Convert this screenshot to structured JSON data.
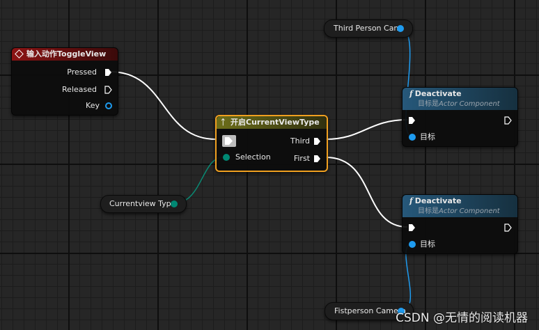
{
  "input_node": {
    "title": "输入动作ToggleView",
    "pressed": "Pressed",
    "released": "Released",
    "key": "Key"
  },
  "switch_node": {
    "title": "开启CurrentViewType",
    "third": "Third",
    "first": "First",
    "selection": "Selection"
  },
  "deactivate_top": {
    "title": "Deactivate",
    "subtitle_prefix": "目标是",
    "subtitle_target": "Actor Component",
    "target_label": "目标"
  },
  "deactivate_bottom": {
    "title": "Deactivate",
    "subtitle_prefix": "目标是",
    "subtitle_target": "Actor Component",
    "target_label": "目标"
  },
  "var_third_person_cam": {
    "label": "Third Person Cam"
  },
  "var_currentview_type": {
    "label": "Currentview Type"
  },
  "var_fistperson_camera": {
    "label": "Fistperson Camera"
  },
  "watermark": "CSDN @无情的阅读机器",
  "icons": {
    "event": "diamond-icon",
    "switch": "switch-icon",
    "function": "function-icon",
    "exec": "exec-pin-icon",
    "data": "data-pin-icon"
  },
  "colors": {
    "event_header": "#8c1414",
    "switch_header": "#6d6e1a",
    "switch_border": "#f0a020",
    "function_header": "#26587a",
    "object_pin": "#1e9bef",
    "enum_pin": "#008873",
    "wire_exec": "#ffffff"
  }
}
